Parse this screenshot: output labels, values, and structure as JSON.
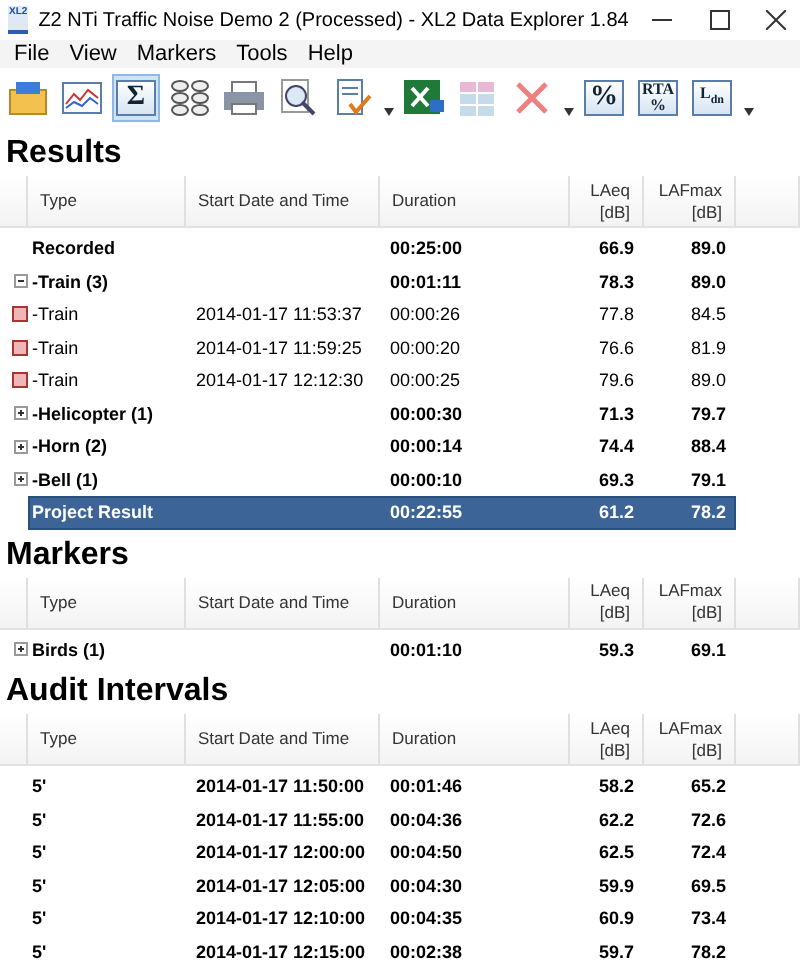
{
  "window": {
    "icon_label": "XL2",
    "title": "Z2 NTi Traffic Noise Demo 2 (Processed) - XL2 Data Explorer 1.84"
  },
  "menu": [
    "File",
    "View",
    "Markers",
    "Tools",
    "Help"
  ],
  "toolbar": [
    {
      "kind": "open",
      "selected": false
    },
    {
      "kind": "chart",
      "selected": false
    },
    {
      "kind": "sum",
      "text": "Σ",
      "selected": true
    },
    {
      "kind": "calc",
      "selected": false
    },
    {
      "kind": "print",
      "selected": false
    },
    {
      "kind": "preview",
      "selected": false
    },
    {
      "kind": "report",
      "selected": false
    },
    {
      "kind": "dropdown",
      "selected": false
    },
    {
      "kind": "excel",
      "selected": false
    },
    {
      "kind": "grid",
      "selected": false
    },
    {
      "kind": "delete",
      "selected": false
    },
    {
      "kind": "dropdown",
      "selected": false
    },
    {
      "kind": "percent",
      "text": "%",
      "selected": false
    },
    {
      "kind": "rta",
      "text": "RTA",
      "sub": "%",
      "selected": false
    },
    {
      "kind": "ldn",
      "text": "L",
      "sub": "dn",
      "selected": false
    },
    {
      "kind": "dropdown",
      "selected": false
    }
  ],
  "sections": [
    {
      "title": "Results",
      "columns": [
        "Type",
        "Start Date and Time",
        "Duration",
        "LAeq\n[dB]",
        "LAFmax\n[dB]"
      ],
      "rows": [
        {
          "kind": "group",
          "cells": [
            "Recorded",
            "",
            "00:25:00",
            "66.9",
            "89.0"
          ],
          "selected": false
        },
        {
          "kind": "group",
          "expanded": true,
          "cells": [
            "-Train (3)",
            "",
            "00:01:11",
            "78.3",
            "89.0"
          ],
          "selected": false
        },
        {
          "kind": "item",
          "cells": [
            "-Train",
            "2014-01-17 11:53:37",
            "00:00:26",
            "77.8",
            "84.5"
          ],
          "selected": false
        },
        {
          "kind": "item",
          "cells": [
            "-Train",
            "2014-01-17 11:59:25",
            "00:00:20",
            "76.6",
            "81.9"
          ],
          "selected": false
        },
        {
          "kind": "item",
          "cells": [
            "-Train",
            "2014-01-17 12:12:30",
            "00:00:25",
            "79.6",
            "89.0"
          ],
          "selected": false
        },
        {
          "kind": "group",
          "expanded": false,
          "cells": [
            "-Helicopter (1)",
            "",
            "00:00:30",
            "71.3",
            "79.7"
          ],
          "selected": false
        },
        {
          "kind": "group",
          "expanded": false,
          "cells": [
            "-Horn (2)",
            "",
            "00:00:14",
            "74.4",
            "88.4"
          ],
          "selected": false
        },
        {
          "kind": "group",
          "expanded": false,
          "cells": [
            "-Bell (1)",
            "",
            "00:00:10",
            "69.3",
            "79.1"
          ],
          "selected": false
        },
        {
          "kind": "group",
          "cells": [
            "Project Result",
            "",
            "00:22:55",
            "61.2",
            "78.2"
          ],
          "selected": true
        }
      ]
    },
    {
      "title": "Markers",
      "columns": [
        "Type",
        "Start Date and Time",
        "Duration",
        "LAeq\n[dB]",
        "LAFmax\n[dB]"
      ],
      "rows": [
        {
          "kind": "group",
          "expanded": false,
          "cells": [
            "Birds (1)",
            "",
            "00:01:10",
            "59.3",
            "69.1"
          ],
          "selected": false
        }
      ]
    },
    {
      "title": "Audit Intervals",
      "columns": [
        "Type",
        "Start Date and Time",
        "Duration",
        "LAeq\n[dB]",
        "LAFmax\n[dB]"
      ],
      "rows": [
        {
          "kind": "group",
          "cells": [
            "5'",
            "2014-01-17 11:50:00",
            "00:01:46",
            "58.2",
            "65.2"
          ],
          "selected": false
        },
        {
          "kind": "group",
          "cells": [
            "5'",
            "2014-01-17 11:55:00",
            "00:04:36",
            "62.2",
            "72.6"
          ],
          "selected": false
        },
        {
          "kind": "group",
          "cells": [
            "5'",
            "2014-01-17 12:00:00",
            "00:04:50",
            "62.5",
            "72.4"
          ],
          "selected": false
        },
        {
          "kind": "group",
          "cells": [
            "5'",
            "2014-01-17 12:05:00",
            "00:04:30",
            "59.9",
            "69.5"
          ],
          "selected": false
        },
        {
          "kind": "group",
          "cells": [
            "5'",
            "2014-01-17 12:10:00",
            "00:04:35",
            "60.9",
            "73.4"
          ],
          "selected": false
        },
        {
          "kind": "group",
          "cells": [
            "5'",
            "2014-01-17 12:15:00",
            "00:02:38",
            "59.7",
            "78.2"
          ],
          "selected": false
        }
      ]
    }
  ]
}
